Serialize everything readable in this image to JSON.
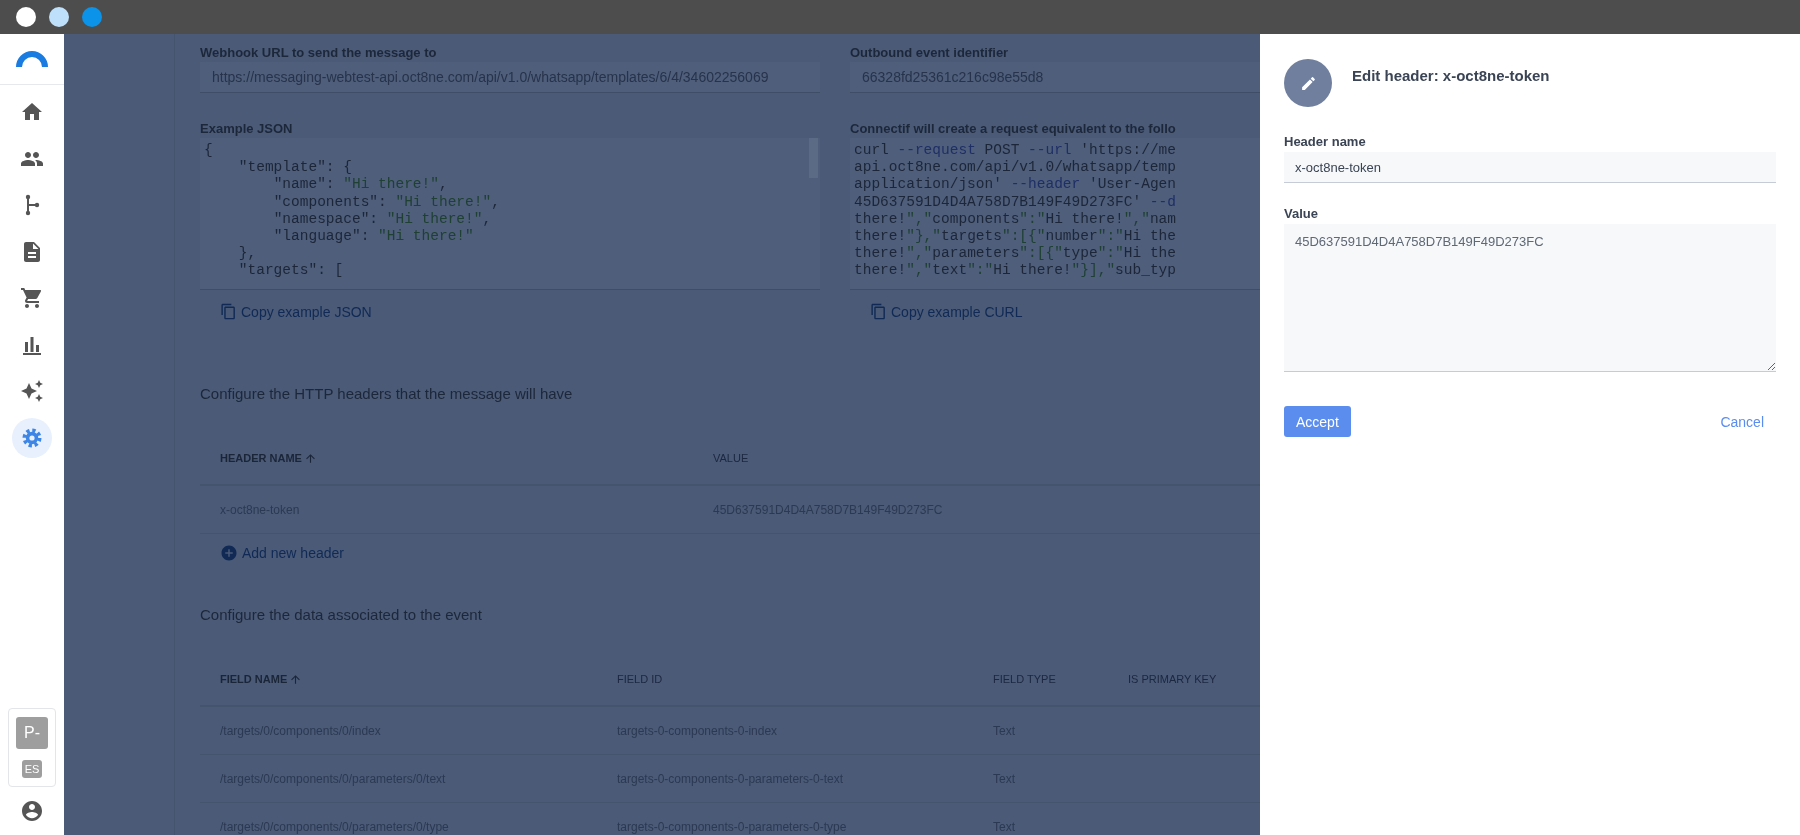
{
  "sidebar": {
    "items": [
      {
        "selected": false
      },
      {
        "selected": false
      },
      {
        "selected": false
      },
      {
        "selected": false
      },
      {
        "selected": false
      },
      {
        "selected": false
      },
      {
        "selected": false
      },
      {
        "selected": true
      }
    ],
    "user": {
      "avatar": "P-",
      "language": "ES"
    }
  },
  "main": {
    "webhook": {
      "label": "Webhook URL to send the message to",
      "value": "https://messaging-webtest-api.oct8ne.com/api/v1.0/whatsapp/templates/6/4/34602256069"
    },
    "outbound": {
      "label": "Outbound event identifier",
      "value": "66328fd25361c216c98e55d8"
    },
    "example_json": {
      "label": "Example JSON",
      "copy": "Copy example JSON",
      "lines": [
        "{",
        "    \"template\": {",
        "        \"name\": \"Hi there!\",",
        "        \"components\": \"Hi there!\",",
        "        \"namespace\": \"Hi there!\",",
        "        \"language\": \"Hi there!\"",
        "    },",
        "    \"targets\": ["
      ]
    },
    "curl": {
      "label": "Connectif will create a request equivalent to the follo",
      "copy": "Copy example CURL",
      "lines": [
        "curl --request POST --url 'https://me",
        "api.oct8ne.com/api/v1.0/whatsapp/temp",
        "application/json' --header 'User-Agen",
        "45D637591D4D4A758D7B149F49D273FC' --d",
        "there!\",\"components\":\"Hi there!\",\"nam",
        "there!\"},\"targets\":[{\"number\":\"Hi the",
        "there!\",\"parameters\":[{\"type\":\"Hi the",
        "there!\",\"text\":\"Hi there!\"}],\"sub_typ"
      ]
    },
    "headers_section": {
      "title": "Configure the HTTP headers that the message will have",
      "add": "Add new header",
      "table": {
        "columns": [
          {
            "label": "HEADER NAME",
            "sorted": true
          },
          {
            "label": "VALUE",
            "sorted": false
          }
        ],
        "rows": [
          [
            "x-oct8ne-token",
            "45D637591D4D4A758D7B149F49D273FC"
          ]
        ]
      }
    },
    "data_section": {
      "title": "Configure the data associated to the event",
      "table": {
        "columns": [
          {
            "label": "FIELD NAME",
            "sorted": true
          },
          {
            "label": "FIELD ID",
            "sorted": false
          },
          {
            "label": "FIELD TYPE",
            "sorted": false
          },
          {
            "label": "IS PRIMARY KEY",
            "sorted": false
          }
        ],
        "rows": [
          [
            "/targets/0/components/0/index",
            "targets-0-components-0-index",
            "Text"
          ],
          [
            "/targets/0/components/0/parameters/0/text",
            "targets-0-components-0-parameters-0-text",
            "Text"
          ],
          [
            "/targets/0/components/0/parameters/0/type",
            "targets-0-components-0-parameters-0-type",
            "Text"
          ]
        ]
      }
    }
  },
  "drawer": {
    "title": "Edit header: x-oct8ne-token",
    "fields": [
      {
        "kind": "input",
        "label": "Header name",
        "value": "x-oct8ne-token"
      },
      {
        "kind": "textarea",
        "label": "Value",
        "value": "45D637591D4D4A758D7B149F49D273FC"
      }
    ],
    "accept": "Accept",
    "cancel": "Cancel"
  }
}
